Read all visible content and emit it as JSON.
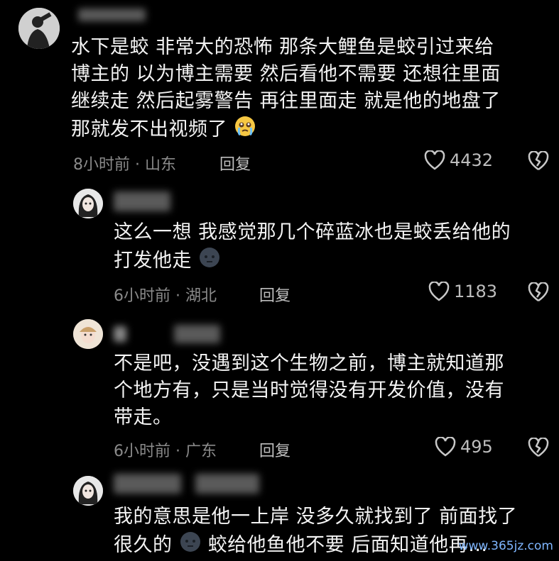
{
  "comments": [
    {
      "lines": [
        "水下是蛟 非常大的恐怖 那条大鲤鱼是蛟引过来给",
        "博主的 以为博主需要 然后看他不需要 还想往里面",
        "继续走 然后起雾警告 再往里面走 就是他的地盘了",
        "那就发不出视频了"
      ],
      "meta": "8小时前 · 山东",
      "reply": "回复",
      "likes": "4432"
    },
    {
      "lines": [
        "这么一想 我感觉那几个碎蓝冰也是蛟丢给他的",
        "打发他走"
      ],
      "meta": "6小时前 · 湖北",
      "reply": "回复",
      "likes": "1183"
    },
    {
      "lines": [
        "不是吧，没遇到这个生物之前，博主就知道那",
        "个地方有，只是当时觉得没有开发价值，没有",
        "带走。"
      ],
      "meta": "6小时前 · 广东",
      "reply": "回复",
      "likes": "495"
    },
    {
      "lines": [
        "我的意思是他一上岸 没多久就找到了 前面找了",
        "很久的",
        "蛟给他鱼他不要 后面知道他再..."
      ],
      "meta": "",
      "reply": "",
      "likes": ""
    }
  ],
  "watermark": "www.365jz.com",
  "icons": {
    "like": "heart-outline-icon",
    "dislike": "broken-heart-icon",
    "emoji1": "crying-face-emoji",
    "emoji2": "dark-face-emoji"
  }
}
